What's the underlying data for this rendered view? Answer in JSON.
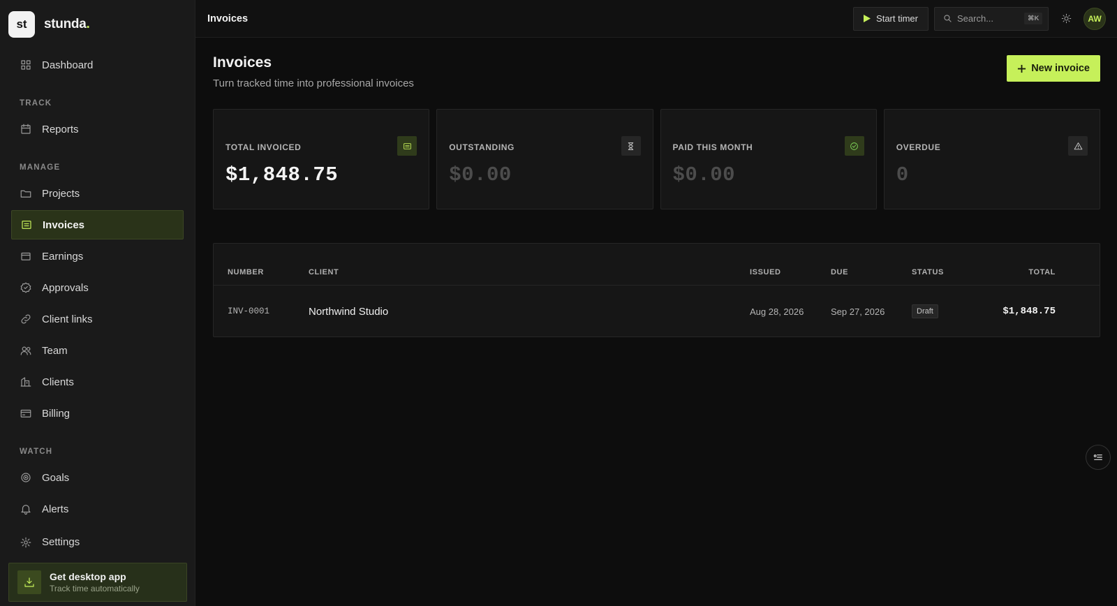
{
  "brand": {
    "logo_text": "st",
    "name": "stunda",
    "name_dot": "."
  },
  "sidebar": {
    "dashboard": "Dashboard",
    "sections": {
      "track": "TRACK",
      "manage": "MANAGE",
      "watch": "WATCH"
    },
    "track_items": [
      "Reports"
    ],
    "manage_items": [
      "Projects",
      "Invoices",
      "Earnings",
      "Approvals",
      "Client links",
      "Team",
      "Clients",
      "Billing"
    ],
    "watch_items": [
      "Goals",
      "Alerts"
    ],
    "settings": "Settings",
    "active_item": "Invoices",
    "desktop_app": {
      "title": "Get desktop app",
      "subtitle": "Track time automatically"
    }
  },
  "topbar": {
    "title": "Invoices",
    "start_timer": "Start timer",
    "search_placeholder": "Search...",
    "search_shortcut": "⌘K",
    "avatar_initials": "AW"
  },
  "page": {
    "title": "Invoices",
    "subtitle": "Turn tracked time into professional invoices",
    "new_invoice": "New invoice"
  },
  "stats": [
    {
      "label": "TOTAL INVOICED",
      "value": "$1,848.75",
      "icon": "invoice-icon"
    },
    {
      "label": "OUTSTANDING",
      "value": "$0.00",
      "icon": "hourglass-icon"
    },
    {
      "label": "PAID THIS MONTH",
      "value": "$0.00",
      "icon": "check-circle-icon"
    },
    {
      "label": "OVERDUE",
      "value": "0",
      "icon": "warning-icon"
    }
  ],
  "table": {
    "headers": {
      "number": "NUMBER",
      "client": "CLIENT",
      "issued": "ISSUED",
      "due": "DUE",
      "status": "STATUS",
      "total": "TOTAL"
    },
    "rows": [
      {
        "number": "INV-0001",
        "client": "Northwind Studio",
        "issued": "Aug 28, 2026",
        "due": "Sep 27, 2026",
        "status": "Draft",
        "total": "$1,848.75"
      }
    ]
  },
  "colors": {
    "accent": "#c6f05a",
    "background": "#0d0d0d",
    "sidebar": "#1a1a1a",
    "card": "#161616"
  }
}
